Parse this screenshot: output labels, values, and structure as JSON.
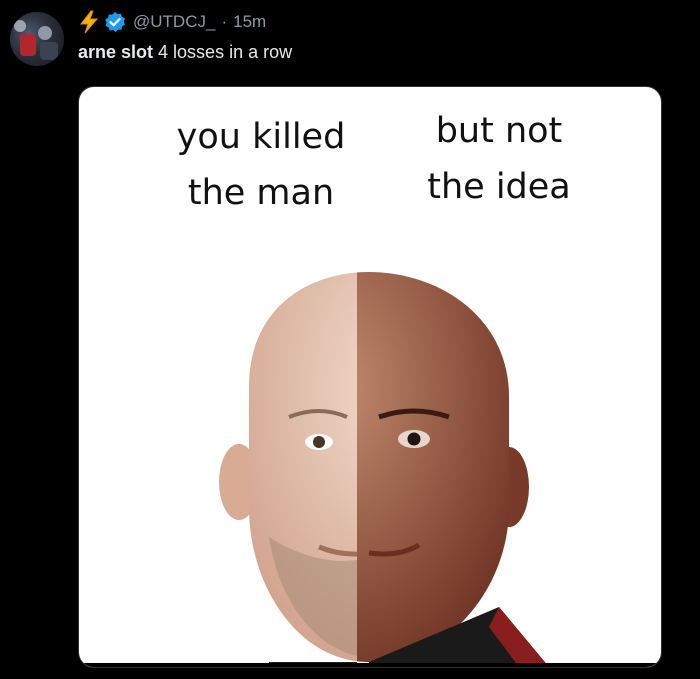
{
  "tweet": {
    "handle": "@UTDCJ_",
    "separator": "·",
    "time": "15m",
    "text_bold": "arne slot",
    "text_rest": " 4 losses in a row"
  },
  "meme": {
    "left_caption_line1": "you killed",
    "left_caption_line2": "the man",
    "right_caption_line1": "but not",
    "right_caption_line2": "the idea"
  },
  "icons": {
    "badge_emoji": "lightning-bolt-icon",
    "verified": "verified-badge-icon"
  },
  "colors": {
    "background": "#000000",
    "text_primary": "#e7e9ea",
    "text_secondary": "#8b98a5",
    "verified_blue": "#1d9bf0",
    "bolt_yellow": "#f5b400"
  }
}
